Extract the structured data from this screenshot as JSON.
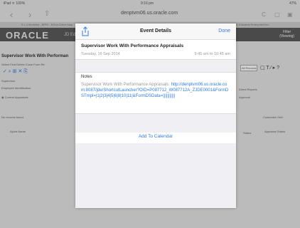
{
  "status": {
    "left": "iPad ᯤ 100%",
    "time": "9:16 pm",
    "battery": "47%"
  },
  "browser": {
    "url": "denptvm06.us.oracle.com",
    "tabs": [
      "9.1.4 Modules - BPRI - EOne Direct Map",
      "JD Edwards",
      "JD Edwards EnterpriseOne"
    ]
  },
  "oracle": {
    "logo": "ORACLE",
    "product": "JD Edwards",
    "filter_label": "Filter",
    "filter_sub": "(Viewing)"
  },
  "background": {
    "form_title": "Supervisor Work With Performan",
    "menu": "Select  Find  Delete  Close  Form  Re",
    "supervisor": "Supervisor",
    "employee_id": "Employee Identification",
    "current_appraisals": "Current Appraisals",
    "no_records": "No records found.",
    "alpha_name": "Alpha Name",
    "all_records": "All Records",
    "direct_reports": "Direct Reports",
    "approval": "Approval",
    "customize_grid": "Customize Grid",
    "status": "Status",
    "appraisal_status": "Appraisal Status"
  },
  "modal": {
    "title": "Event Details",
    "done": "Done",
    "event_title": "Supervisor Work With Performance Appraisals",
    "date": "Tuesday, 16 Sep 2014",
    "time": "9:45 am to 10:45 am",
    "notes_label": "Notes",
    "notes_prefix": "Supervisor Work With Performance Appraisals: ",
    "notes_link": "http://denptvm06.us.oracle.com:8087/jde/ShortcutLauncher?OID=P087712_W087712A_ZJDE0001&FormDSTmpl=|1|2|3|4|5|6|8|10|11|&FormDSData=|||||||||||",
    "add_to_calendar": "Add To Calendar"
  },
  "colors": {
    "accent": "#2c7be5"
  }
}
